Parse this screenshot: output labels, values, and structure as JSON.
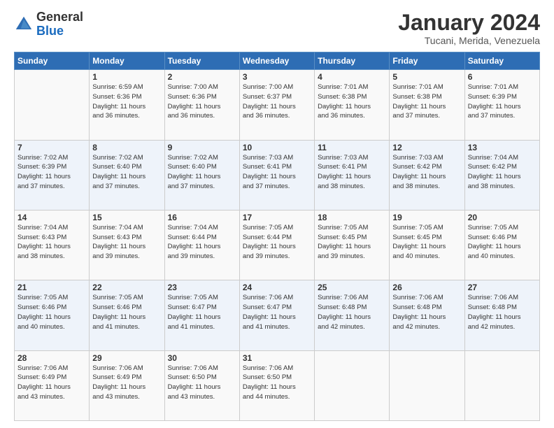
{
  "logo": {
    "general": "General",
    "blue": "Blue"
  },
  "title": "January 2024",
  "location": "Tucani, Merida, Venezuela",
  "header_days": [
    "Sunday",
    "Monday",
    "Tuesday",
    "Wednesday",
    "Thursday",
    "Friday",
    "Saturday"
  ],
  "weeks": [
    [
      {
        "day": "",
        "info": ""
      },
      {
        "day": "1",
        "info": "Sunrise: 6:59 AM\nSunset: 6:36 PM\nDaylight: 11 hours\nand 36 minutes."
      },
      {
        "day": "2",
        "info": "Sunrise: 7:00 AM\nSunset: 6:36 PM\nDaylight: 11 hours\nand 36 minutes."
      },
      {
        "day": "3",
        "info": "Sunrise: 7:00 AM\nSunset: 6:37 PM\nDaylight: 11 hours\nand 36 minutes."
      },
      {
        "day": "4",
        "info": "Sunrise: 7:01 AM\nSunset: 6:38 PM\nDaylight: 11 hours\nand 36 minutes."
      },
      {
        "day": "5",
        "info": "Sunrise: 7:01 AM\nSunset: 6:38 PM\nDaylight: 11 hours\nand 37 minutes."
      },
      {
        "day": "6",
        "info": "Sunrise: 7:01 AM\nSunset: 6:39 PM\nDaylight: 11 hours\nand 37 minutes."
      }
    ],
    [
      {
        "day": "7",
        "info": "Sunrise: 7:02 AM\nSunset: 6:39 PM\nDaylight: 11 hours\nand 37 minutes."
      },
      {
        "day": "8",
        "info": "Sunrise: 7:02 AM\nSunset: 6:40 PM\nDaylight: 11 hours\nand 37 minutes."
      },
      {
        "day": "9",
        "info": "Sunrise: 7:02 AM\nSunset: 6:40 PM\nDaylight: 11 hours\nand 37 minutes."
      },
      {
        "day": "10",
        "info": "Sunrise: 7:03 AM\nSunset: 6:41 PM\nDaylight: 11 hours\nand 37 minutes."
      },
      {
        "day": "11",
        "info": "Sunrise: 7:03 AM\nSunset: 6:41 PM\nDaylight: 11 hours\nand 38 minutes."
      },
      {
        "day": "12",
        "info": "Sunrise: 7:03 AM\nSunset: 6:42 PM\nDaylight: 11 hours\nand 38 minutes."
      },
      {
        "day": "13",
        "info": "Sunrise: 7:04 AM\nSunset: 6:42 PM\nDaylight: 11 hours\nand 38 minutes."
      }
    ],
    [
      {
        "day": "14",
        "info": "Sunrise: 7:04 AM\nSunset: 6:43 PM\nDaylight: 11 hours\nand 38 minutes."
      },
      {
        "day": "15",
        "info": "Sunrise: 7:04 AM\nSunset: 6:43 PM\nDaylight: 11 hours\nand 39 minutes."
      },
      {
        "day": "16",
        "info": "Sunrise: 7:04 AM\nSunset: 6:44 PM\nDaylight: 11 hours\nand 39 minutes."
      },
      {
        "day": "17",
        "info": "Sunrise: 7:05 AM\nSunset: 6:44 PM\nDaylight: 11 hours\nand 39 minutes."
      },
      {
        "day": "18",
        "info": "Sunrise: 7:05 AM\nSunset: 6:45 PM\nDaylight: 11 hours\nand 39 minutes."
      },
      {
        "day": "19",
        "info": "Sunrise: 7:05 AM\nSunset: 6:45 PM\nDaylight: 11 hours\nand 40 minutes."
      },
      {
        "day": "20",
        "info": "Sunrise: 7:05 AM\nSunset: 6:46 PM\nDaylight: 11 hours\nand 40 minutes."
      }
    ],
    [
      {
        "day": "21",
        "info": "Sunrise: 7:05 AM\nSunset: 6:46 PM\nDaylight: 11 hours\nand 40 minutes."
      },
      {
        "day": "22",
        "info": "Sunrise: 7:05 AM\nSunset: 6:46 PM\nDaylight: 11 hours\nand 41 minutes."
      },
      {
        "day": "23",
        "info": "Sunrise: 7:05 AM\nSunset: 6:47 PM\nDaylight: 11 hours\nand 41 minutes."
      },
      {
        "day": "24",
        "info": "Sunrise: 7:06 AM\nSunset: 6:47 PM\nDaylight: 11 hours\nand 41 minutes."
      },
      {
        "day": "25",
        "info": "Sunrise: 7:06 AM\nSunset: 6:48 PM\nDaylight: 11 hours\nand 42 minutes."
      },
      {
        "day": "26",
        "info": "Sunrise: 7:06 AM\nSunset: 6:48 PM\nDaylight: 11 hours\nand 42 minutes."
      },
      {
        "day": "27",
        "info": "Sunrise: 7:06 AM\nSunset: 6:48 PM\nDaylight: 11 hours\nand 42 minutes."
      }
    ],
    [
      {
        "day": "28",
        "info": "Sunrise: 7:06 AM\nSunset: 6:49 PM\nDaylight: 11 hours\nand 43 minutes."
      },
      {
        "day": "29",
        "info": "Sunrise: 7:06 AM\nSunset: 6:49 PM\nDaylight: 11 hours\nand 43 minutes."
      },
      {
        "day": "30",
        "info": "Sunrise: 7:06 AM\nSunset: 6:50 PM\nDaylight: 11 hours\nand 43 minutes."
      },
      {
        "day": "31",
        "info": "Sunrise: 7:06 AM\nSunset: 6:50 PM\nDaylight: 11 hours\nand 44 minutes."
      },
      {
        "day": "",
        "info": ""
      },
      {
        "day": "",
        "info": ""
      },
      {
        "day": "",
        "info": ""
      }
    ]
  ]
}
